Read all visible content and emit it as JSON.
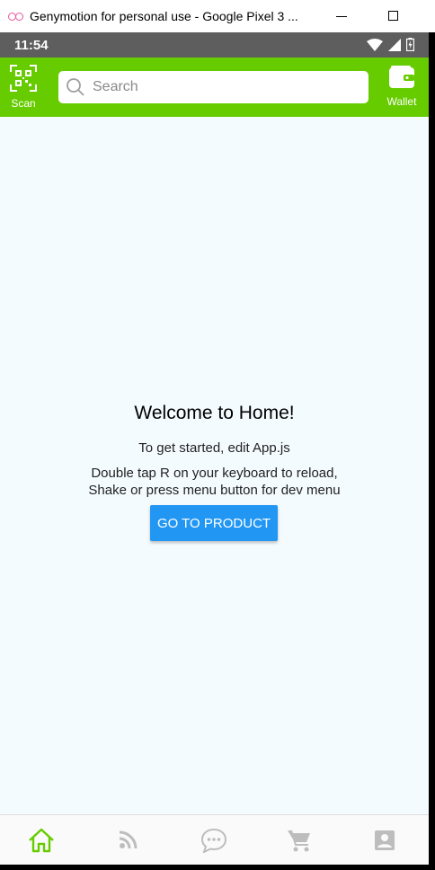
{
  "window": {
    "title": "Genymotion for personal use - Google Pixel 3 ..."
  },
  "status_bar": {
    "time": "11:54",
    "icons": [
      "wifi-icon",
      "signal-icon",
      "battery-icon"
    ]
  },
  "header": {
    "scan_label": "Scan",
    "search_placeholder": "Search",
    "wallet_label": "Wallet",
    "background_color": "#66cc00"
  },
  "main": {
    "welcome": "Welcome to Home!",
    "started": "To get started, edit App.js",
    "instructions_line1": "Double tap R on your keyboard to reload,",
    "instructions_line2": "Shake or press menu button for dev menu",
    "button_label": "GO TO PRODUCT",
    "button_color": "#2196f3"
  },
  "tabs": [
    {
      "icon": "home-icon",
      "active": true
    },
    {
      "icon": "feed-icon",
      "active": false
    },
    {
      "icon": "chat-icon",
      "active": false
    },
    {
      "icon": "cart-icon",
      "active": false
    },
    {
      "icon": "profile-icon",
      "active": false
    }
  ],
  "colors": {
    "active_tab": "#66cc00",
    "inactive_tab": "#bdbdbd",
    "content_background": "#f4fbff"
  }
}
